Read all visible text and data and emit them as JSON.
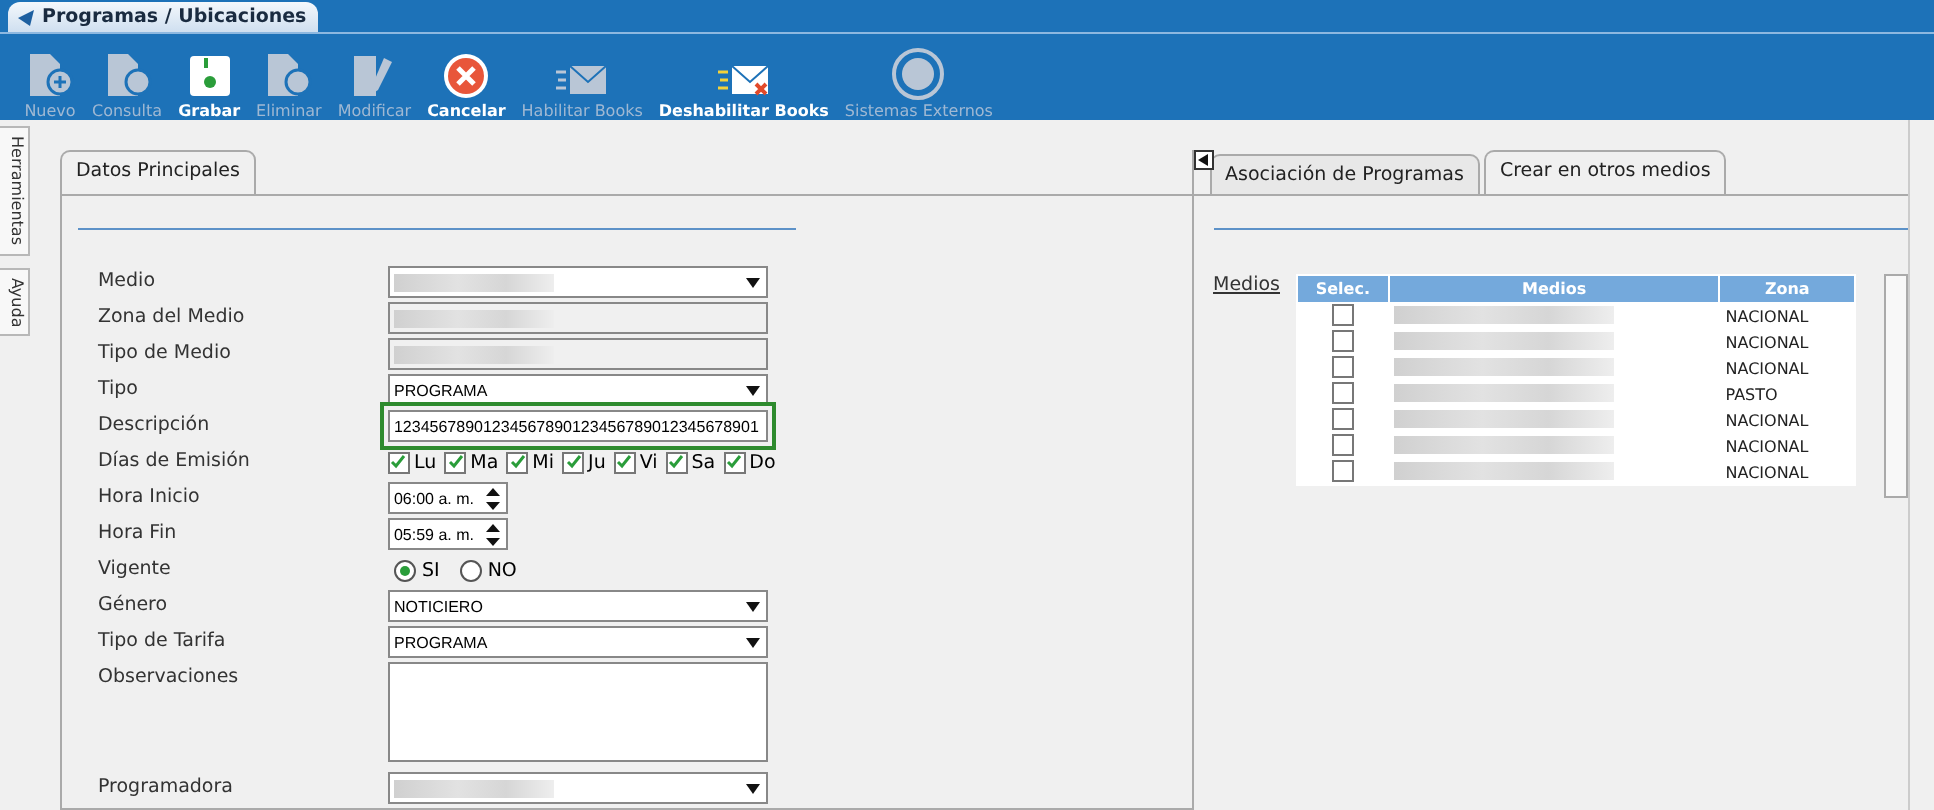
{
  "window": {
    "title": "Programas / Ubicaciones"
  },
  "toolbar": [
    {
      "label": "Nuevo",
      "disabled": true
    },
    {
      "label": "Consulta",
      "disabled": true
    },
    {
      "label": "Grabar",
      "disabled": false
    },
    {
      "label": "Eliminar",
      "disabled": true
    },
    {
      "label": "Modificar",
      "disabled": true
    },
    {
      "label": "Cancelar",
      "disabled": false
    },
    {
      "label": "Habilitar Books",
      "disabled": true
    },
    {
      "label": "Deshabilitar Books",
      "disabled": false
    },
    {
      "label": "Sistemas Externos",
      "disabled": true
    }
  ],
  "side_tabs": [
    "Herramientas",
    "Ayuda"
  ],
  "left_panel": {
    "tabs": [
      {
        "label": "Datos Principales",
        "selected": true
      }
    ],
    "fields": [
      {
        "label": "Medio",
        "kind": "select",
        "redacted": true
      },
      {
        "label": "Zona del Medio",
        "kind": "text",
        "redacted": true
      },
      {
        "label": "Tipo de Medio",
        "kind": "text",
        "redacted": true
      },
      {
        "label": "Tipo",
        "kind": "select",
        "value": "PROGRAMA"
      },
      {
        "label": "Descripción",
        "kind": "text",
        "value": "12345678901234567890123456789012345678901",
        "focused": true
      },
      {
        "label": "Días de Emisión",
        "kind": "days",
        "days": [
          {
            "label": "Lu",
            "checked": true
          },
          {
            "label": "Ma",
            "checked": true
          },
          {
            "label": "Mi",
            "checked": true
          },
          {
            "label": "Ju",
            "checked": true
          },
          {
            "label": "Vi",
            "checked": true
          },
          {
            "label": "Sa",
            "checked": true
          },
          {
            "label": "Do",
            "checked": true
          }
        ]
      },
      {
        "label": "Hora Inicio",
        "kind": "time",
        "value": "06:00 a. m."
      },
      {
        "label": "Hora Fin",
        "kind": "time",
        "value": "05:59 a. m."
      },
      {
        "label": "Vigente",
        "kind": "radio",
        "options": [
          {
            "label": "SI",
            "selected": true
          },
          {
            "label": "NO",
            "selected": false
          }
        ]
      },
      {
        "label": "Género",
        "kind": "select",
        "value": "NOTICIERO"
      },
      {
        "label": "Tipo de Tarifa",
        "kind": "select",
        "value": "PROGRAMA"
      },
      {
        "label": "Observaciones",
        "kind": "textarea"
      },
      {
        "label": "Programadora",
        "kind": "select",
        "redacted": true
      }
    ]
  },
  "right_panel": {
    "tabs": [
      {
        "label": "Asociación de Programas",
        "selected": false
      },
      {
        "label": "Crear en otros medios",
        "selected": true
      }
    ],
    "table_label": "Medios",
    "columns": [
      "Selec.",
      "Medios",
      "Zona"
    ],
    "rows": [
      {
        "selected": false,
        "zona": "NACIONAL"
      },
      {
        "selected": false,
        "zona": "NACIONAL"
      },
      {
        "selected": false,
        "zona": "NACIONAL"
      },
      {
        "selected": false,
        "zona": "PASTO"
      },
      {
        "selected": false,
        "zona": "NACIONAL"
      },
      {
        "selected": false,
        "zona": "NACIONAL"
      },
      {
        "selected": false,
        "zona": "NACIONAL"
      }
    ]
  }
}
